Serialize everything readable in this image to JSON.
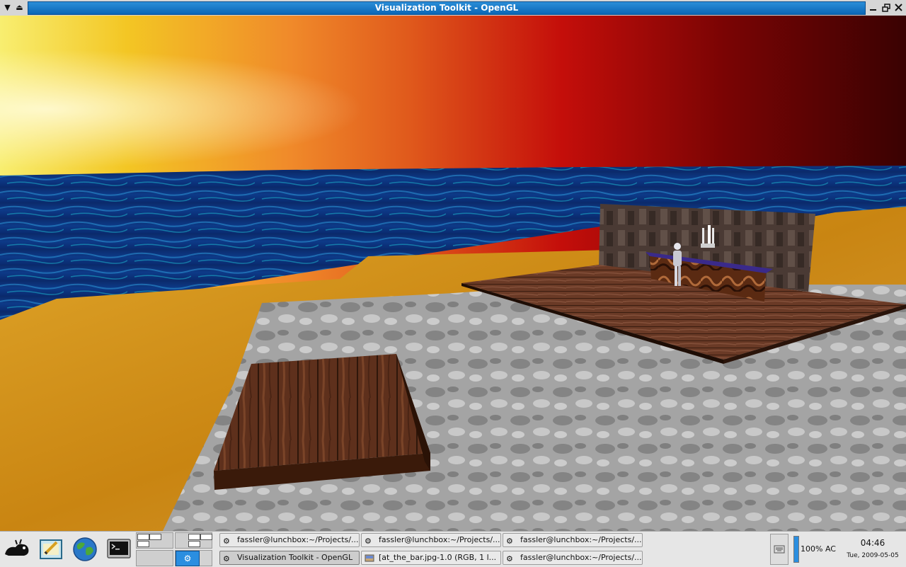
{
  "window": {
    "title": "Visualization Toolkit - OpenGL",
    "menu_icon": "arrow-down-triangle-icon",
    "shade_icon": "arrow-up-triangle-icon",
    "minimize_icon": "minimize-icon",
    "restore_icon": "restore-icon",
    "close_icon": "close-icon",
    "accent_color": "#0a66b6"
  },
  "scene": {
    "sky_colors": [
      "#f8ee70",
      "#f08a2a",
      "#c40e0a",
      "#3a0202"
    ],
    "water_color": "#0c2f78",
    "sand_color": "#d99a22",
    "rock_color": "#9a9a9a",
    "wood_color": "#5a2f1c"
  },
  "taskbar": {
    "launchers": [
      {
        "name": "xfce-mouse-menu-icon"
      },
      {
        "name": "text-editor-icon"
      },
      {
        "name": "web-browser-globe-icon"
      },
      {
        "name": "terminal-icon"
      }
    ],
    "tasks": [
      {
        "label": "fassler@lunchbox:~/Projects/...",
        "icon": "gear-icon"
      },
      {
        "label": "fassler@lunchbox:~/Projects/...",
        "icon": "gear-icon"
      },
      {
        "label": "fassler@lunchbox:~/Projects/...",
        "icon": "gear-icon"
      },
      {
        "label": "Visualization Toolkit - OpenGL",
        "icon": "gear-icon",
        "active": true
      },
      {
        "label": "[at_the_bar.jpg-1.0 (RGB, 1 l...",
        "icon": "image-viewer-icon"
      },
      {
        "label": "fassler@lunchbox:~/Projects/...",
        "icon": "gear-icon"
      }
    ],
    "battery": {
      "text": "100% AC",
      "level": 1.0
    },
    "clock": {
      "time": "04:46",
      "date": "Tue, 2009-05-05"
    }
  }
}
